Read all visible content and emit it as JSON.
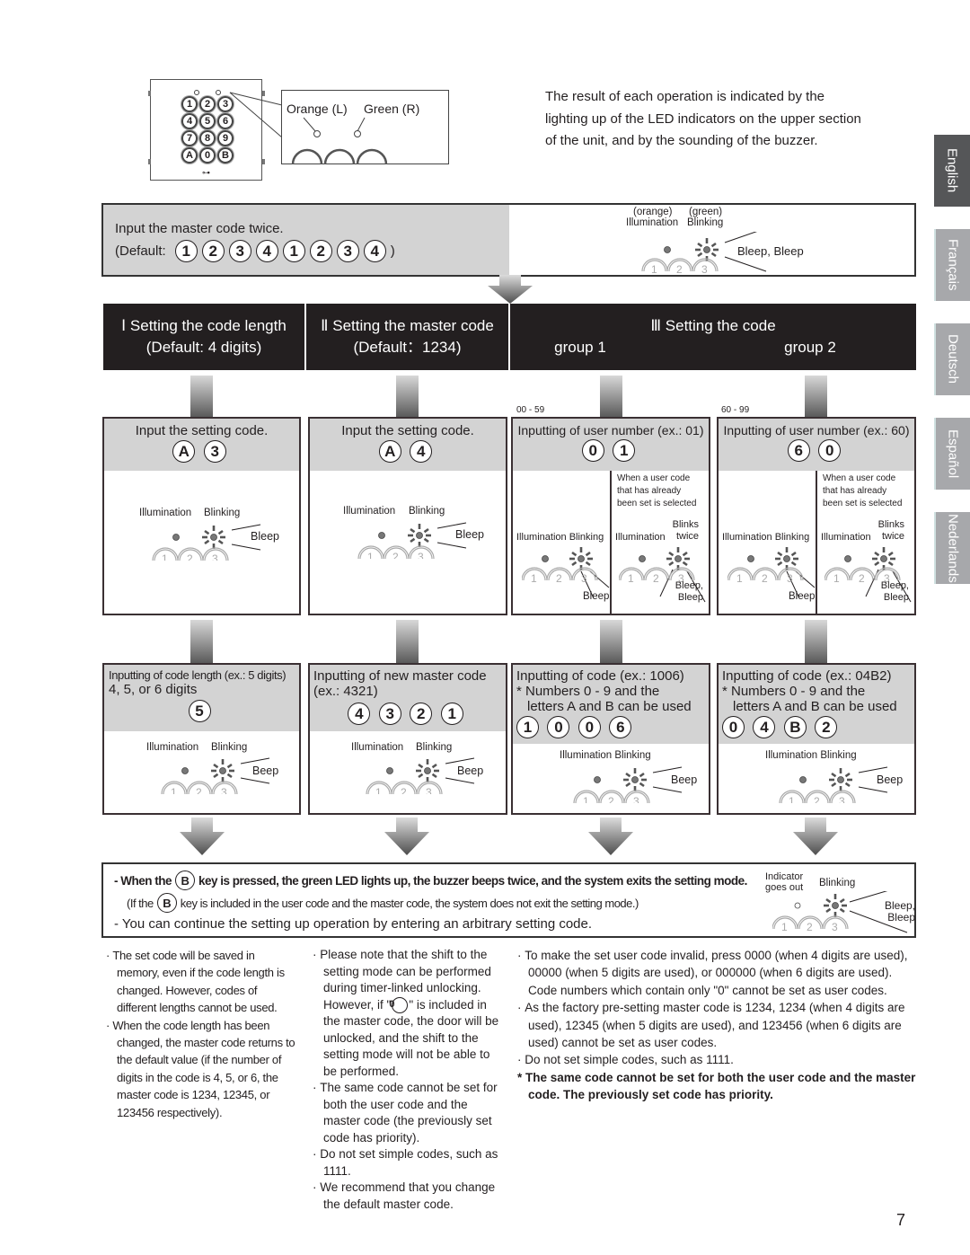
{
  "device": {
    "keys": [
      "1",
      "2",
      "3",
      "4",
      "5",
      "6",
      "7",
      "8",
      "9",
      "A",
      "0",
      "B"
    ],
    "callout_left": "Orange (L)",
    "callout_right": "Green (R)"
  },
  "intro_lines": [
    "The result of each operation is indicated by the",
    "lighting up of the LED indicators on the upper section",
    "of the unit, and by the sounding of the buzzer."
  ],
  "language_tabs": [
    {
      "label": "English",
      "active": true
    },
    {
      "label": "Français",
      "active": false
    },
    {
      "label": "Deutsch",
      "active": false
    },
    {
      "label": "Español",
      "active": false
    },
    {
      "label": "Nederlands",
      "active": false
    }
  ],
  "master_box": {
    "line1": "Input the master code twice.",
    "default_label": "(Default:",
    "default_close": ")",
    "keys": [
      "1",
      "2",
      "3",
      "4",
      "1",
      "2",
      "3",
      "4"
    ],
    "led_orange": "(orange)",
    "led_green": "(green)",
    "led_illumination": "Illumination",
    "led_blinking": "Blinking",
    "sound": "Bleep, Bleep"
  },
  "header": {
    "col1_title": "Ⅰ Setting the code length",
    "col1_sub": "(Default: 4 digits)",
    "col2_title": "Ⅱ Setting the master code",
    "col2_sub": "(Default：1234)",
    "col3_title": "Ⅲ Setting the code",
    "group1": "group 1",
    "group2": "group 2"
  },
  "step1": [
    {
      "title": "Input the setting code.",
      "keys": [
        "A",
        "3"
      ],
      "illum": "Illumination",
      "blink": "Blinking",
      "sound": "Bleep"
    },
    {
      "title": "Input the setting code.",
      "keys": [
        "A",
        "4"
      ],
      "illum": "Illumination",
      "blink": "Blinking",
      "sound": "Bleep"
    },
    {
      "range": "00 - 59",
      "title": "Inputting of user number (ex.:  01)",
      "keys": [
        "0",
        "1"
      ],
      "left_illum": "Illumination Blinking",
      "left_sound": "Bleep",
      "note": "When a user code that has already been set is selected",
      "right_illum": "Illumination",
      "right_blink": "Blinks twice",
      "right_sound": "Bleep, Bleep"
    },
    {
      "range": "60 - 99",
      "title": "Inputting of user number (ex.:  60)",
      "keys": [
        "6",
        "0"
      ],
      "left_illum": "Illumination Blinking",
      "left_sound": "Bleep",
      "note": "When a user code that has already been set is selected",
      "right_illum": "Illumination",
      "right_blink": "Blinks twice",
      "right_sound": "Bleep, Bleep"
    }
  ],
  "step2": [
    {
      "line1": "Inputting of code length (ex.:  5 digits)",
      "line2": "4, 5, or 6 digits",
      "keys": [
        "5"
      ],
      "illum": "Illumination",
      "blink": "Blinking",
      "sound": "Beep"
    },
    {
      "line1": "Inputting of new master code",
      "line2": "(ex.:  4321)",
      "keys": [
        "4",
        "3",
        "2",
        "1"
      ],
      "illum": "Illumination",
      "blink": "Blinking",
      "sound": "Beep"
    },
    {
      "line1": "Inputting of code (ex.: 1006)",
      "line2": "* Numbers 0 - 9 and the",
      "line3": "letters A and B can be used",
      "keys": [
        "1",
        "0",
        "0",
        "6"
      ],
      "illum": "Illumination Blinking",
      "sound": "Beep"
    },
    {
      "line1": "Inputting of code (ex.: 04B2)",
      "line2": "* Numbers 0 - 9 and the",
      "line3": "letters A and B can be used",
      "keys": [
        "0",
        "4",
        "B",
        "2"
      ],
      "illum": "Illumination Blinking",
      "sound": "Beep"
    }
  ],
  "exit_box": {
    "line1_pre": "- When the",
    "line1_key": "B",
    "line1_post": "key is pressed, the green LED lights up, the buzzer beeps twice, and the system exits the setting mode.",
    "line2_pre": "(If the",
    "line2_key": "B",
    "line2_post": "key is included in the user code and the master code, the system does not exit the setting mode.)",
    "line3": "- You can continue the setting up operation by entering an arbitrary setting code.",
    "indicator": "Indicator goes out",
    "blink": "Blinking",
    "sound": "Bleep, Bleep"
  },
  "notes_col1": [
    "The set code will be saved in memory, even if the code length is changed. However, codes of different lengths cannot be used.",
    "When the code length has been changed, the master code returns to the default value (if the number of digits in the code is 4, 5, or 6, the master code is 1234, 12345, or 123456 respectively)."
  ],
  "notes_col2": [
    {
      "pre": "Please note that the shift to the setting mode can be performed during timer-linked unlocking. However, if \"",
      "key": "0",
      "post": "\" is included in the master code, the door will be unlocked, and the shift to the setting mode will not be able to be performed."
    },
    {
      "pre": "The same code cannot be set for both the user code and the master code (the previously set code has priority)."
    },
    {
      "pre": "Do not set simple codes, such as 1111."
    },
    {
      "pre": "We recommend that you change the default master code."
    }
  ],
  "notes_col3": [
    "To make the set user code invalid, press 0000 (when 4 digits are used), 00000 (when 5 digits are used), or 000000 (when 6 digits are used). Code numbers which contain only \"0\" cannot be set as user codes.",
    "As the factory pre-setting master code is 1234, 1234 (when 4 digits are used), 12345 (when 5 digits are used), and 123456 (when 6 digits are used) cannot be set as user codes.",
    "Do not set simple codes, such as 1111."
  ],
  "notes_col3_bold": "* The same code cannot be set for both the user code and the master code. The previously set code has priority.",
  "page_number": "7"
}
